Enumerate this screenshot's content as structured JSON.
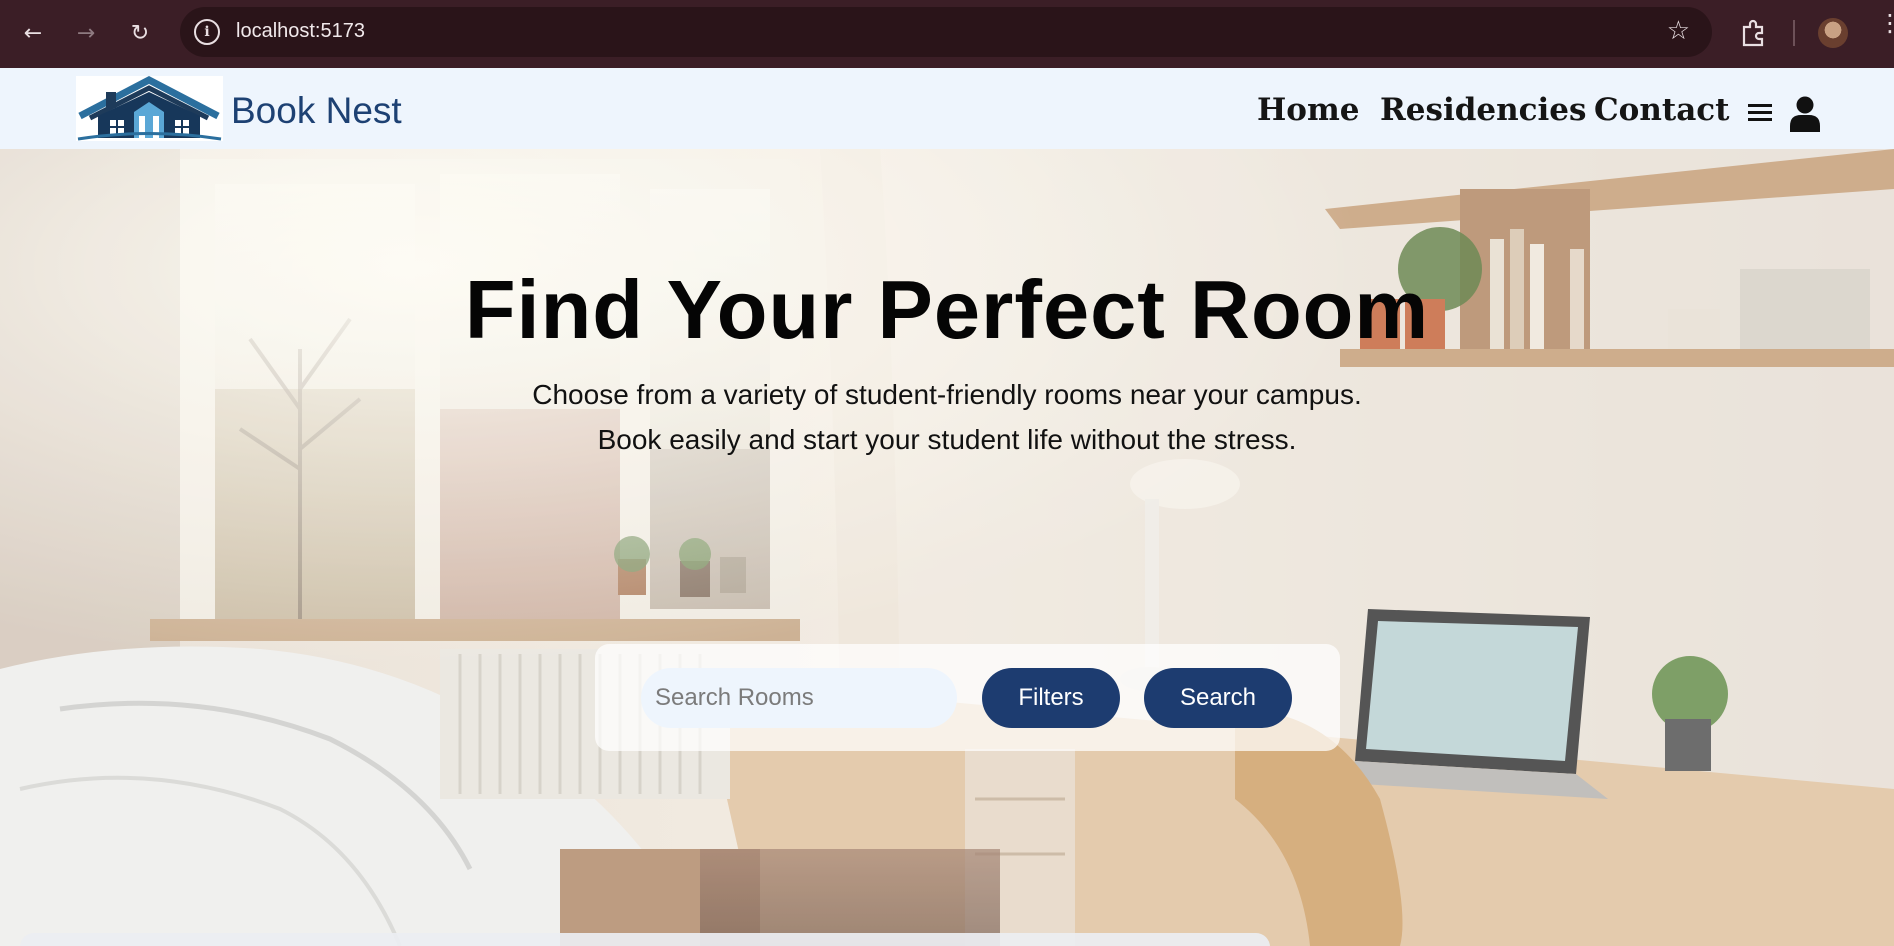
{
  "browser": {
    "url": "localhost:5173",
    "icons": [
      "back-icon",
      "forward-icon",
      "reload-icon",
      "site-info-icon",
      "bookmark-star-icon",
      "extensions-icon",
      "profile-avatar",
      "browser-menu-icon"
    ]
  },
  "header": {
    "brand_name": "Book Nest",
    "nav": [
      "Home",
      "Residencies",
      "Contact"
    ],
    "icons": [
      "hamburger-menu-icon",
      "user-account-icon"
    ]
  },
  "hero": {
    "title": "Find Your Perfect Room",
    "subtitle_line1": "Choose from a variety of student-friendly rooms near your campus.",
    "subtitle_line2": "Book easily and start your student life without the stress."
  },
  "search": {
    "placeholder": "Search Rooms",
    "value": "",
    "filters_label": "Filters",
    "search_label": "Search"
  },
  "colors": {
    "browser_chrome": "#3b1e26",
    "header_bg": "#eef5fd",
    "brand": "#1d4173",
    "button": "#1d3c70"
  }
}
